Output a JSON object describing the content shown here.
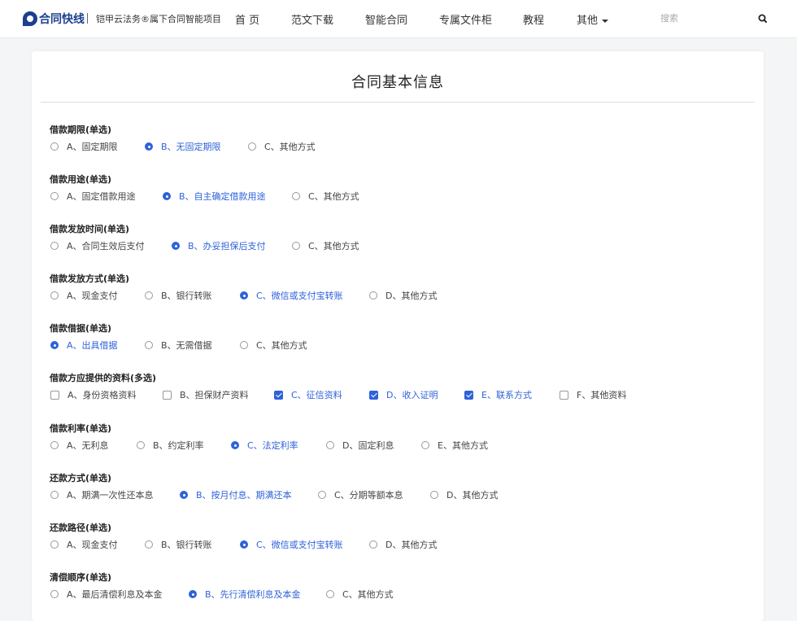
{
  "header": {
    "logo_text": "合同快线",
    "subtitle": "铠甲云法务®属下合同智能项目",
    "nav": [
      {
        "label": "首 页"
      },
      {
        "label": "范文下载"
      },
      {
        "label": "智能合同"
      },
      {
        "label": "专属文件柜"
      },
      {
        "label": "教程"
      },
      {
        "label": "其他"
      }
    ],
    "search_placeholder": "搜索",
    "search_icon": "search-icon"
  },
  "colors": {
    "accent": "#2f62d9",
    "logo": "#1d3f8f"
  },
  "form": {
    "title": "合同基本信息",
    "questions": [
      {
        "label": "借款期限(单选)",
        "type": "radio",
        "options": [
          {
            "text": "A、固定期限",
            "selected": false
          },
          {
            "text": "B、无固定期限",
            "selected": true
          },
          {
            "text": "C、其他方式",
            "selected": false
          }
        ]
      },
      {
        "label": "借款用途(单选)",
        "type": "radio",
        "options": [
          {
            "text": "A、固定借款用途",
            "selected": false
          },
          {
            "text": "B、自主确定借款用途",
            "selected": true
          },
          {
            "text": "C、其他方式",
            "selected": false
          }
        ]
      },
      {
        "label": "借款发放时间(单选)",
        "type": "radio",
        "options": [
          {
            "text": "A、合同生效后支付",
            "selected": false
          },
          {
            "text": "B、办妥担保后支付",
            "selected": true
          },
          {
            "text": "C、其他方式",
            "selected": false
          }
        ]
      },
      {
        "label": "借款发放方式(单选)",
        "type": "radio",
        "options": [
          {
            "text": "A、现金支付",
            "selected": false
          },
          {
            "text": "B、银行转账",
            "selected": false
          },
          {
            "text": "C、微信或支付宝转账",
            "selected": true
          },
          {
            "text": "D、其他方式",
            "selected": false
          }
        ]
      },
      {
        "label": "借款借据(单选)",
        "type": "radio",
        "options": [
          {
            "text": "A、出具借据",
            "selected": true
          },
          {
            "text": "B、无需借据",
            "selected": false
          },
          {
            "text": "C、其他方式",
            "selected": false
          }
        ]
      },
      {
        "label": "借款方应提供的资料(多选)",
        "type": "checkbox",
        "options": [
          {
            "text": "A、身份资格资料",
            "selected": false
          },
          {
            "text": "B、担保财产资料",
            "selected": false
          },
          {
            "text": "C、征信资料",
            "selected": true
          },
          {
            "text": "D、收入证明",
            "selected": true
          },
          {
            "text": "E、联系方式",
            "selected": true
          },
          {
            "text": "F、其他资料",
            "selected": false
          }
        ]
      },
      {
        "label": "借款利率(单选)",
        "type": "radio",
        "options": [
          {
            "text": "A、无利息",
            "selected": false
          },
          {
            "text": "B、约定利率",
            "selected": false
          },
          {
            "text": "C、法定利率",
            "selected": true
          },
          {
            "text": "D、固定利息",
            "selected": false
          },
          {
            "text": "E、其他方式",
            "selected": false
          }
        ]
      },
      {
        "label": "还款方式(单选)",
        "type": "radio",
        "options": [
          {
            "text": "A、期满一次性还本息",
            "selected": false
          },
          {
            "text": "B、按月付息、期满还本",
            "selected": true
          },
          {
            "text": "C、分期等额本息",
            "selected": false
          },
          {
            "text": "D、其他方式",
            "selected": false
          }
        ]
      },
      {
        "label": "还款路径(单选)",
        "type": "radio",
        "options": [
          {
            "text": "A、现金支付",
            "selected": false
          },
          {
            "text": "B、银行转账",
            "selected": false
          },
          {
            "text": "C、微信或支付宝转账",
            "selected": true
          },
          {
            "text": "D、其他方式",
            "selected": false
          }
        ]
      },
      {
        "label": "清偿顺序(单选)",
        "type": "radio",
        "options": [
          {
            "text": "A、最后清偿利息及本金",
            "selected": false
          },
          {
            "text": "B、先行清偿利息及本金",
            "selected": true
          },
          {
            "text": "C、其他方式",
            "selected": false
          }
        ]
      }
    ]
  }
}
